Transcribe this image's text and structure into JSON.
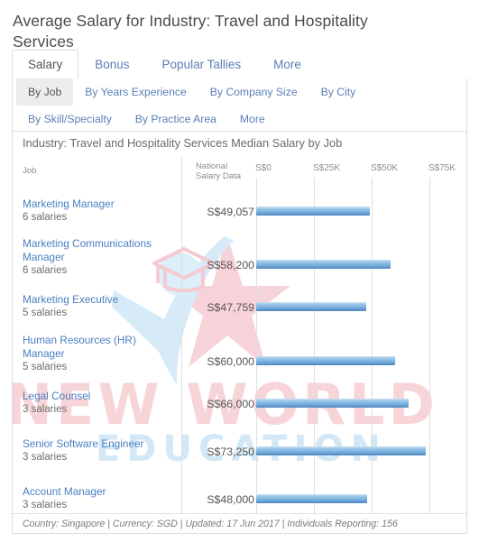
{
  "page_title": "Average Salary for Industry: Travel and Hospitality Services",
  "primary_tabs": [
    {
      "label": "Salary",
      "active": true
    },
    {
      "label": "Bonus",
      "active": false
    },
    {
      "label": "Popular Tallies",
      "active": false
    },
    {
      "label": "More",
      "active": false
    }
  ],
  "secondary_tabs": [
    {
      "label": "By Job",
      "active": true
    },
    {
      "label": "By Years Experience",
      "active": false
    },
    {
      "label": "By Company Size",
      "active": false
    },
    {
      "label": "By City",
      "active": false
    },
    {
      "label": "By Skill/Specialty",
      "active": false
    },
    {
      "label": "By Practice Area",
      "active": false
    },
    {
      "label": "More",
      "active": false
    }
  ],
  "columns": {
    "job": "Job",
    "national_salary_data": "National Salary Data"
  },
  "footer": "Country: Singapore  |  Currency: SGD  |  Updated: 17 Jun 2017  |  Individuals Reporting: 156",
  "watermark": {
    "line1": "NEW WORLD",
    "line2": "EDUCATION",
    "color_line1": "#f7d4d8",
    "color_line2": "#d3e8f6"
  },
  "colors": {
    "link": "#4a7fc1",
    "bar_light": "#a9cdea",
    "bar_dark": "#4f84ba",
    "gridline": "#dfdfdf",
    "border": "#dcdcdc"
  },
  "chart_data": {
    "type": "bar",
    "title": "Industry: Travel and Hospitality Services Median Salary by Job",
    "orientation": "horizontal",
    "xlabel": "",
    "ylabel": "Job",
    "xlim": [
      0,
      82000
    ],
    "grid": true,
    "legend": "none",
    "tick_labels": [
      "S$0",
      "S$25K",
      "S$50K",
      "S$75K"
    ],
    "tick_values": [
      0,
      25000,
      50000,
      75000
    ],
    "categories": [
      "Marketing Manager",
      "Marketing Communications Manager",
      "Marketing Executive",
      "Human Resources (HR) Manager",
      "Legal Counsel",
      "Senior Software Engineer",
      "Account Manager"
    ],
    "values": [
      49057,
      58200,
      47759,
      60000,
      66000,
      73250,
      48000
    ],
    "value_labels": [
      "S$49,057",
      "S$58,200",
      "S$47,759",
      "S$60,000",
      "S$66,000",
      "S$73,250",
      "S$48,000"
    ],
    "sample_sizes": [
      "6 salaries",
      "6 salaries",
      "5 salaries",
      "5 salaries",
      "3 salaries",
      "3 salaries",
      "3 salaries"
    ]
  }
}
